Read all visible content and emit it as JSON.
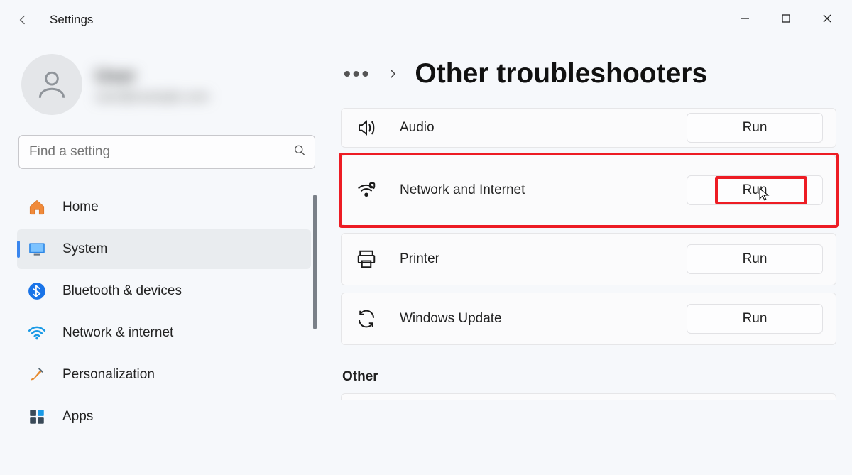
{
  "window": {
    "app_title": "Settings"
  },
  "profile": {
    "name": "User",
    "email": "user@example.com"
  },
  "search": {
    "placeholder": "Find a setting"
  },
  "sidebar": {
    "items": [
      {
        "id": "home",
        "label": "Home"
      },
      {
        "id": "system",
        "label": "System"
      },
      {
        "id": "bluetooth",
        "label": "Bluetooth & devices"
      },
      {
        "id": "network",
        "label": "Network & internet"
      },
      {
        "id": "personalization",
        "label": "Personalization"
      },
      {
        "id": "apps",
        "label": "Apps"
      }
    ],
    "active_index": 1
  },
  "breadcrumb": {
    "title": "Other troubleshooters"
  },
  "troubleshooters": [
    {
      "id": "audio",
      "label": "Audio",
      "action": "Run"
    },
    {
      "id": "network_internet",
      "label": "Network and Internet",
      "action": "Run",
      "highlighted": true
    },
    {
      "id": "printer",
      "label": "Printer",
      "action": "Run"
    },
    {
      "id": "windows_update",
      "label": "Windows Update",
      "action": "Run"
    }
  ],
  "section_other": "Other"
}
